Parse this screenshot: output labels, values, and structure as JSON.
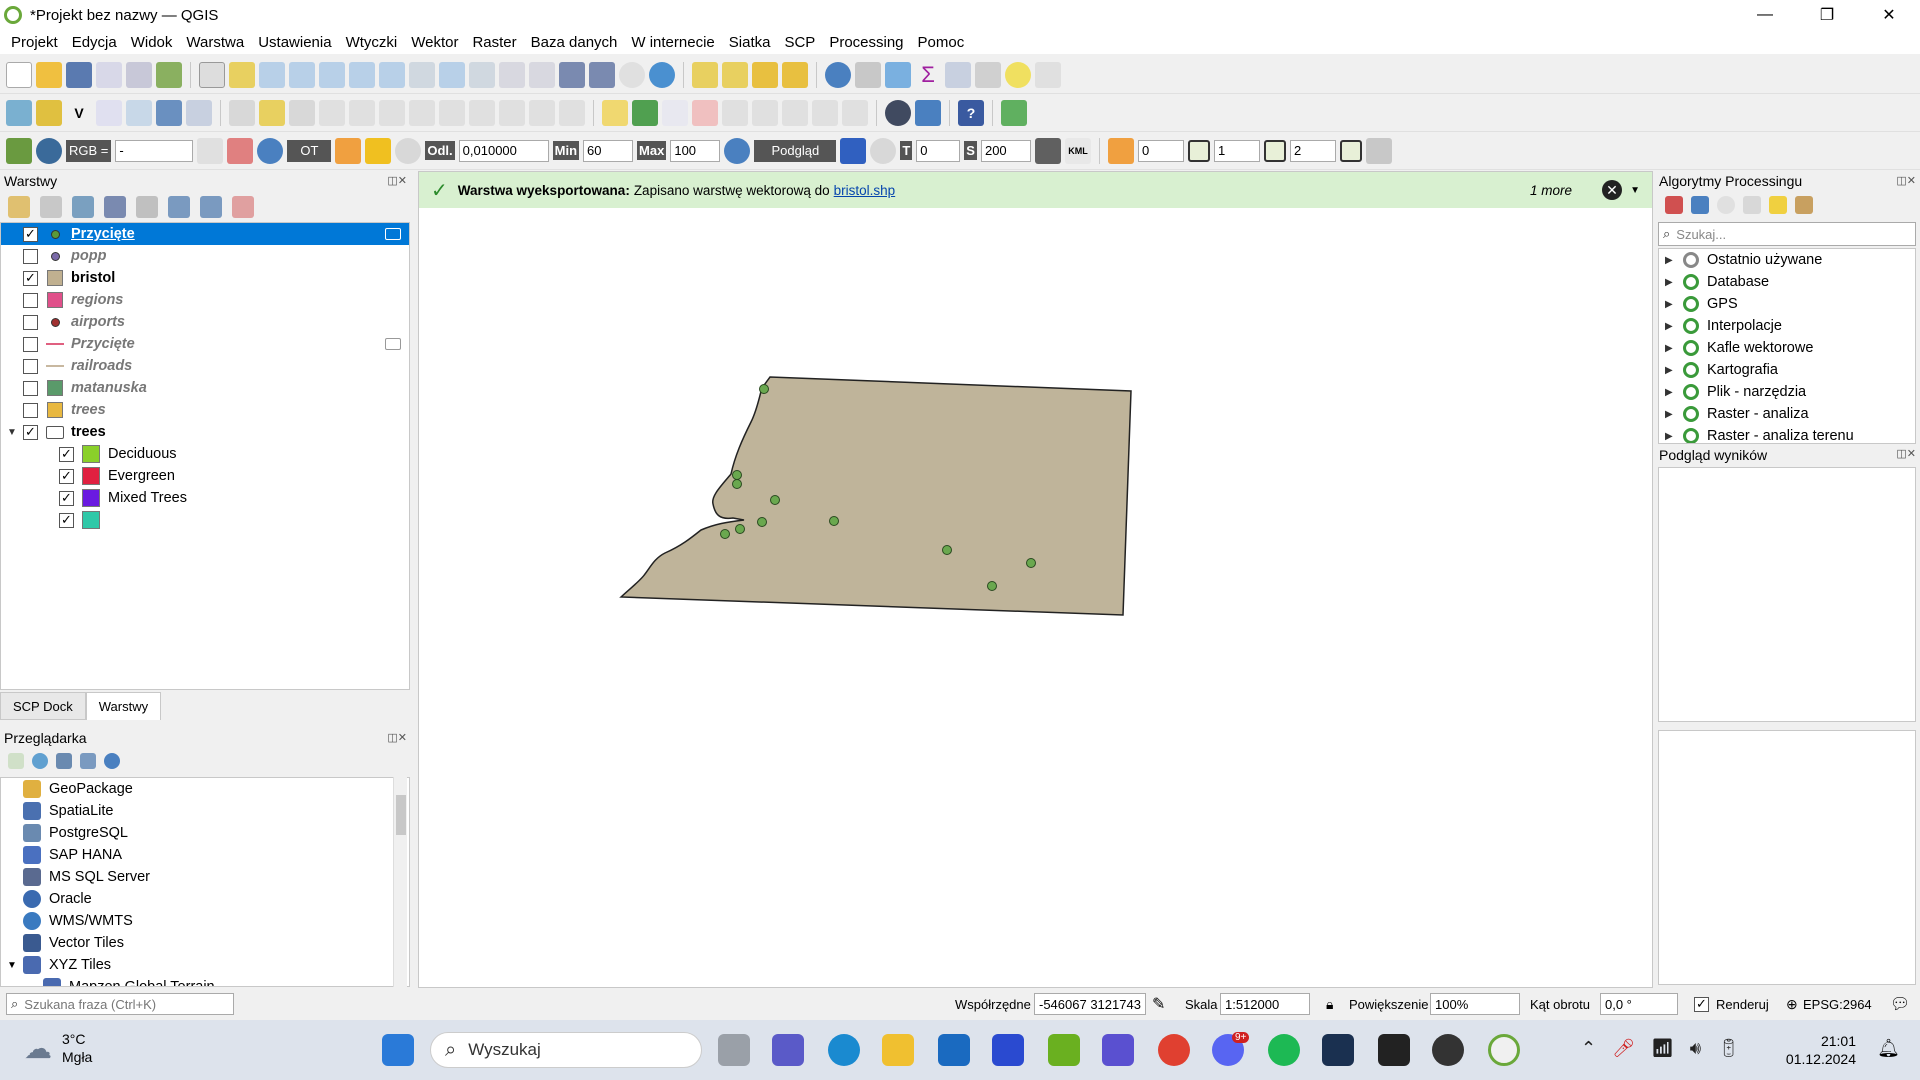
{
  "window": {
    "title": "*Projekt bez nazwy — QGIS",
    "controls": [
      "—",
      "❐",
      "✕"
    ]
  },
  "menu": [
    "Projekt",
    "Edycja",
    "Widok",
    "Warstwa",
    "Ustawienia",
    "Wtyczki",
    "Wektor",
    "Raster",
    "Baza danych",
    "W internecie",
    "Siatka",
    "SCP",
    "Processing",
    "Pomoc"
  ],
  "toolbar3": {
    "rgb_label": "RGB =",
    "rgb_value": "-",
    "ot_label": "OT",
    "odl_label": "Odl.",
    "odl_value": "0,010000",
    "min_label": "Min",
    "min_value": "60",
    "max_label": "Max",
    "max_value": "100",
    "podglad_label": "Podgląd",
    "t_label": "T",
    "t_value": "0",
    "s_label": "S",
    "s_value": "200",
    "kml_label": "KML",
    "band1": "0",
    "band2": "1",
    "band3": "2"
  },
  "layers_panel": {
    "title": "Warstwy",
    "items": [
      {
        "name": "Przycięte",
        "checked": true,
        "style": "sel",
        "sym": "point",
        "color": "#5a9a3a"
      },
      {
        "name": "popp",
        "checked": false,
        "style": "i",
        "sym": "point",
        "color": "#7a6aa8"
      },
      {
        "name": "bristol",
        "checked": true,
        "style": "b",
        "sym": "fill",
        "color": "#c0b090"
      },
      {
        "name": "regions",
        "checked": false,
        "style": "i",
        "sym": "fill",
        "color": "#e0508a"
      },
      {
        "name": "airports",
        "checked": false,
        "style": "i",
        "sym": "point",
        "color": "#a03030"
      },
      {
        "name": "Przycięte",
        "checked": false,
        "style": "i",
        "sym": "line",
        "color": "#e06080"
      },
      {
        "name": "railroads",
        "checked": false,
        "style": "i",
        "sym": "line",
        "color": "#c8b8a0"
      },
      {
        "name": "matanuska",
        "checked": false,
        "style": "i",
        "sym": "fill",
        "color": "#5a9a6a"
      },
      {
        "name": "trees",
        "checked": false,
        "style": "i",
        "sym": "fill",
        "color": "#e8b840"
      },
      {
        "name": "trees",
        "checked": true,
        "style": "b",
        "sym": "group",
        "color": "#ffffff"
      }
    ],
    "categories": [
      {
        "name": "Deciduous",
        "color": "#8ad02a"
      },
      {
        "name": "Evergreen",
        "color": "#e02040"
      },
      {
        "name": "Mixed Trees",
        "color": "#6a1ae0"
      },
      {
        "name": "",
        "color": "#30c8a8"
      }
    ],
    "tabs": [
      "SCP Dock",
      "Warstwy"
    ]
  },
  "browser_panel": {
    "title": "Przeglądarka",
    "items": [
      "GeoPackage",
      "SpatiaLite",
      "PostgreSQL",
      "SAP HANA",
      "MS SQL Server",
      "Oracle",
      "WMS/WMTS",
      "Vector Tiles",
      "XYZ Tiles",
      "Mapzen Global Terrain"
    ]
  },
  "message": {
    "bold": "Warstwa wyeksportowana:",
    "text": "Zapisano warstwę wektorową do",
    "link": "bristol.shp",
    "more": "1 more"
  },
  "processing_panel": {
    "title": "Algorytmy Processingu",
    "search_placeholder": "Szukaj...",
    "items": [
      "Ostatnio używane",
      "Database",
      "GPS",
      "Interpolacje",
      "Kafle wektorowe",
      "Kartografia",
      "Plik - narzędzia",
      "Raster - analiza",
      "Raster - analiza terenu"
    ]
  },
  "results_panel": {
    "title": "Podgląd wyników"
  },
  "statusbar": {
    "search_placeholder": "Szukana fraza (Ctrl+K)",
    "coords_label": "Współrzędne",
    "coords_value": "-546067 3121743",
    "scale_label": "Skala",
    "scale_value": "1:512000",
    "zoom_label": "Powiększenie",
    "zoom_value": "100%",
    "rotation_label": "Kąt obrotu",
    "rotation_value": "0,0 °",
    "render_label": "Renderuj",
    "crs": "EPSG:2964"
  },
  "taskbar": {
    "temp": "3°C",
    "weather": "Mgła",
    "search": "Wyszukaj",
    "time": "21:01",
    "date": "01.12.2024",
    "discord_badge": "9+"
  },
  "colors": {
    "polygon_fill": "#bfb49a",
    "polygon_stroke": "#222222",
    "point_fill": "#6aa84f",
    "selection": "#0078d7",
    "message_bg": "#d8f0d0"
  }
}
